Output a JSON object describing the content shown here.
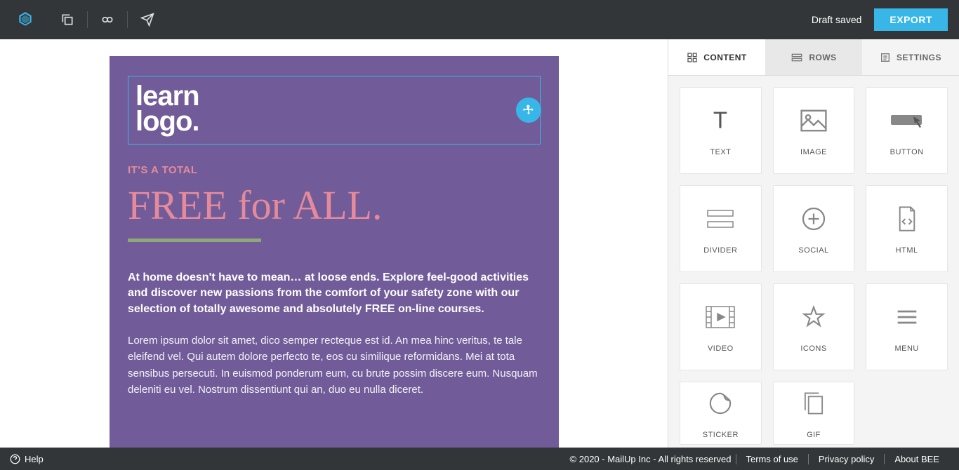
{
  "header": {
    "draft_saved": "Draft saved",
    "export": "EXPORT"
  },
  "tabs": {
    "content": "CONTENT",
    "rows": "ROWS",
    "settings": "SETTINGS"
  },
  "tiles": [
    "TEXT",
    "IMAGE",
    "BUTTON",
    "DIVIDER",
    "SOCIAL",
    "HTML",
    "VIDEO",
    "ICONS",
    "MENU",
    "STICKER",
    "GIF"
  ],
  "email": {
    "logo_line1": "learn",
    "logo_line2": "logo.",
    "subhead": "IT'S A TOTAL",
    "headline": "FREE for ALL.",
    "body_bold": "At home doesn't have to mean… at loose ends. Explore feel-good activities and discover new passions from the comfort of your safety zone with our selection of totally awesome and absolutely FREE on-line courses.",
    "body_text": "Lorem ipsum dolor sit amet, dico semper recteque est id. An mea hinc veritus, te tale eleifend vel. Qui autem dolore perfecto te, eos cu similique reformidans. Mei at tota sensibus persecuti. In euismod ponderum eum, cu brute possim discere eum. Nusquam deleniti eu vel. Nostrum dissentiunt qui an, duo eu nulla diceret."
  },
  "footer": {
    "help": "Help",
    "copyright": "© 2020 - MailUp Inc - All rights reserved",
    "terms": "Terms of use",
    "privacy": "Privacy policy",
    "about": "About BEE"
  }
}
